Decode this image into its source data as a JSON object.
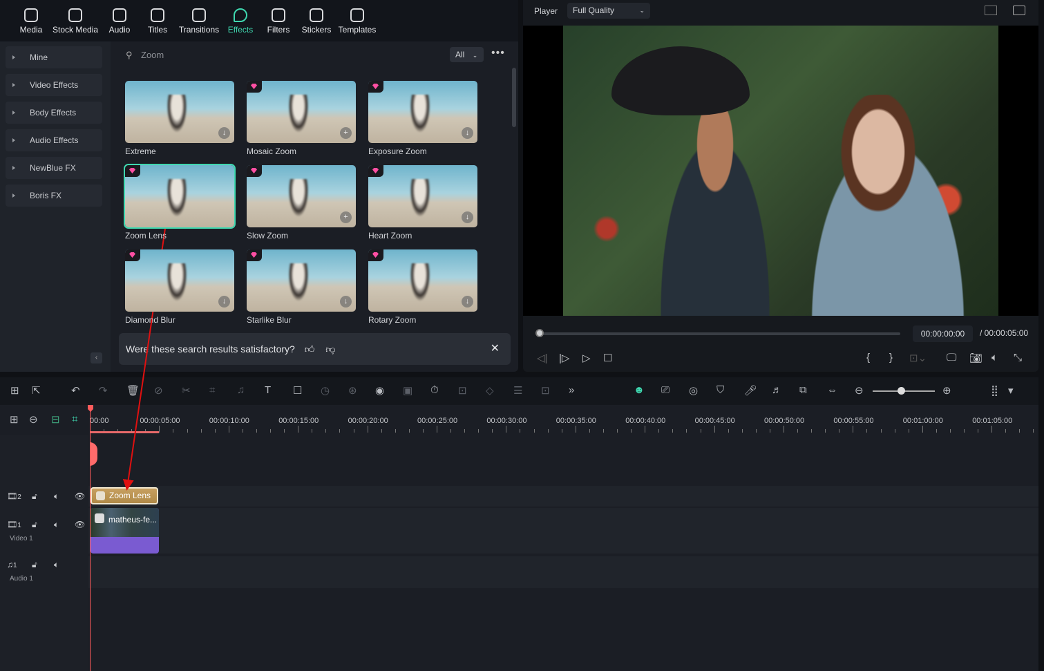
{
  "nav": [
    {
      "label": "Media",
      "icon": "media-icon"
    },
    {
      "label": "Stock Media",
      "icon": "stock-media-icon"
    },
    {
      "label": "Audio",
      "icon": "audio-icon"
    },
    {
      "label": "Titles",
      "icon": "titles-icon"
    },
    {
      "label": "Transitions",
      "icon": "transitions-icon"
    },
    {
      "label": "Effects",
      "icon": "effects-icon",
      "active": true
    },
    {
      "label": "Filters",
      "icon": "filters-icon"
    },
    {
      "label": "Stickers",
      "icon": "stickers-icon"
    },
    {
      "label": "Templates",
      "icon": "templates-icon"
    }
  ],
  "sidebar": {
    "items": [
      {
        "label": "Mine"
      },
      {
        "label": "Video Effects"
      },
      {
        "label": "Body Effects"
      },
      {
        "label": "Audio Effects"
      },
      {
        "label": "NewBlue FX"
      },
      {
        "label": "Boris FX"
      }
    ]
  },
  "search": {
    "value": "Zoom",
    "filter": "All"
  },
  "effects": [
    {
      "label": "Extreme",
      "premium": false,
      "action": "download"
    },
    {
      "label": "Mosaic Zoom",
      "premium": true,
      "action": "add"
    },
    {
      "label": "Exposure Zoom",
      "premium": true,
      "action": "download"
    },
    {
      "label": "Zoom Lens",
      "premium": true,
      "action": "",
      "selected": true
    },
    {
      "label": "Slow Zoom",
      "premium": true,
      "action": "add"
    },
    {
      "label": "Heart Zoom",
      "premium": true,
      "action": "download"
    },
    {
      "label": "Diamond Blur",
      "premium": true,
      "action": "download"
    },
    {
      "label": "Starlike Blur",
      "premium": true,
      "action": "download"
    },
    {
      "label": "Rotary Zoom",
      "premium": true,
      "action": "download"
    }
  ],
  "feedback": {
    "question": "Were these search results satisfactory?"
  },
  "player": {
    "label": "Player",
    "quality": "Full Quality",
    "current": "00:00:00:00",
    "total": "/  00:00:05:00",
    "progress": 0
  },
  "ruler": [
    "00:00",
    "00:00:05:00",
    "00:00:10:00",
    "00:00:15:00",
    "00:00:20:00",
    "00:00:25:00",
    "00:00:30:00",
    "00:00:35:00",
    "00:00:40:00",
    "00:00:45:00",
    "00:00:50:00",
    "00:00:55:00",
    "00:01:00:00",
    "00:01:05:00"
  ],
  "tracks": {
    "fx_num": "2",
    "video_num": "1",
    "video_name": "Video 1",
    "audio_num": "1",
    "audio_name": "Audio 1"
  },
  "clips": {
    "effect": "Zoom Lens",
    "video": "matheus-fe..."
  },
  "colors": {
    "accent": "#3fd8b0",
    "playhead": "#ff5b5b",
    "effect_clip": "#c7a060",
    "video_clip": "#7a5bd1"
  }
}
